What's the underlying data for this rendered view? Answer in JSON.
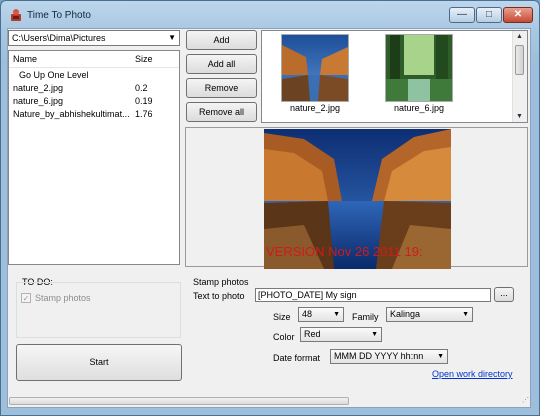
{
  "window": {
    "title": "Time To Photo",
    "minimize": "—",
    "maximize": "□",
    "close": "✕"
  },
  "folder": {
    "path": "C:\\Users\\Dima\\Pictures"
  },
  "filelist": {
    "headers": {
      "name": "Name",
      "size": "Size"
    },
    "rows": [
      {
        "name": "Go Up One Level",
        "size": ""
      },
      {
        "name": "nature_2.jpg",
        "size": "0.2"
      },
      {
        "name": "nature_6.jpg",
        "size": "0.19"
      },
      {
        "name": "Nature_by_abhishekultimat...",
        "size": "1.76"
      }
    ]
  },
  "buttons": {
    "add": "Add",
    "add_all": "Add all",
    "remove": "Remove",
    "remove_all": "Remove all",
    "start": "Start",
    "dash": "..."
  },
  "thumbnails": [
    {
      "label": "nature_2.jpg"
    },
    {
      "label": "nature_6.jpg"
    }
  ],
  "preview": {
    "stamp_text": "VERSION  Nov 26 2011 19:"
  },
  "todo": {
    "title": "TO DO:",
    "stamp_photos": "Stamp photos",
    "stamp_checked": true
  },
  "stamp": {
    "title": "Stamp photos",
    "text_label": "Text to photo",
    "text_value": "[PHOTO_DATE] My sign",
    "size_label": "Size",
    "size_value": "48",
    "family_label": "Family",
    "family_value": "Kalinga",
    "color_label": "Color",
    "color_value": "Red",
    "date_label": "Date format",
    "date_value": "MMM DD YYYY hh:nn",
    "open_dir": "Open work directory"
  }
}
